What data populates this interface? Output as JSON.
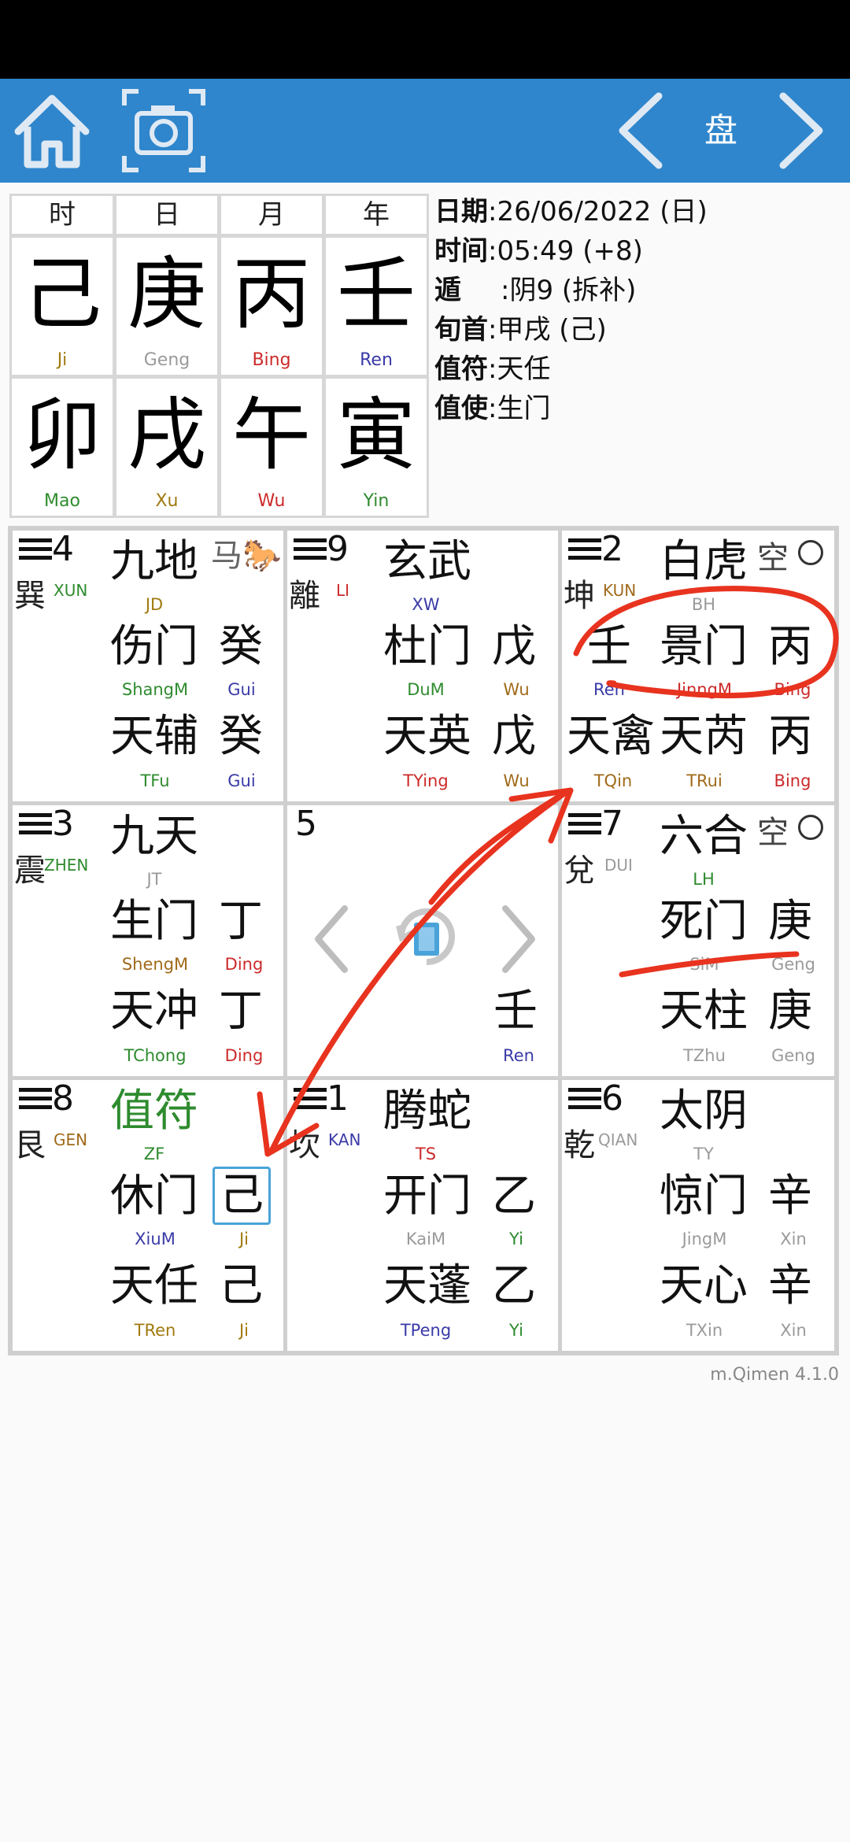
{
  "toolbar": {
    "home_icon": "home-icon",
    "camera_icon": "camera-icon",
    "title": "盘",
    "prev_icon": "chevron-left-icon",
    "next_icon": "chevron-right-icon"
  },
  "pillars": {
    "headers": [
      "时",
      "日",
      "月",
      "年"
    ],
    "stems": [
      "己",
      "庚",
      "丙",
      "壬"
    ],
    "stems_py": [
      "Ji",
      "Geng",
      "Bing",
      "Ren"
    ],
    "branches": [
      "卯",
      "戌",
      "午",
      "寅"
    ],
    "branches_py": [
      "Mao",
      "Xu",
      "Wu",
      "Yin"
    ]
  },
  "info": {
    "date_key": "日期",
    "date_val": ":26/06/2022 (日)",
    "time_key": "时间",
    "time_val": ":05:49 (+8)",
    "dun_key": "遁",
    "dun_val": ":阴9 (拆补)",
    "xun_key": "旬首",
    "xun_val": ":甲戌 (己)",
    "zhifu_key": "值符",
    "zhifu_val": ":天任",
    "zhishi_key": "值使",
    "zhishi_val": ":生门"
  },
  "grid": {
    "p4": {
      "num": "4",
      "name": "巽",
      "py": "XUN",
      "god": "九地",
      "god_py": "JD",
      "horse": "马🐎",
      "door": "伤门",
      "door_py": "ShangM",
      "door_stem": "癸",
      "door_stem_py": "Gui",
      "star": "天辅",
      "star_py": "TFu",
      "star_stem": "癸",
      "star_stem_py": "Gui"
    },
    "p9": {
      "num": "9",
      "name": "離",
      "py": "LI",
      "god": "玄武",
      "god_py": "XW",
      "door": "杜门",
      "door_py": "DuM",
      "door_stem": "戊",
      "door_stem_py": "Wu",
      "star": "天英",
      "star_py": "TYing",
      "star_stem": "戊",
      "star_stem_py": "Wu"
    },
    "p2": {
      "num": "2",
      "name": "坤",
      "py": "KUN",
      "god": "白虎",
      "god_py": "BH",
      "void": "空",
      "left_stem": "壬",
      "left_stem_py": "Ren",
      "door": "景门",
      "door_py": "JinngM",
      "door_stem": "丙",
      "door_stem_py": "Bing",
      "star0": "天禽",
      "star0_py": "TQin",
      "star": "天芮",
      "star_py": "TRui",
      "star_stem": "丙",
      "star_stem_py": "Bing"
    },
    "p3": {
      "num": "3",
      "name": "震",
      "py": "ZHEN",
      "god": "九天",
      "god_py": "JT",
      "door": "生门",
      "door_py": "ShengM",
      "door_stem": "丁",
      "door_stem_py": "Ding",
      "star": "天冲",
      "star_py": "TChong",
      "star_stem": "丁",
      "star_stem_py": "Ding"
    },
    "p5": {
      "num": "5",
      "stem": "壬",
      "stem_py": "Ren"
    },
    "p7": {
      "num": "7",
      "name": "兌",
      "py": "DUI",
      "god": "六合",
      "god_py": "LH",
      "void": "空",
      "door": "死门",
      "door_py": "SiM",
      "door_stem": "庚",
      "door_stem_py": "Geng",
      "star": "天柱",
      "star_py": "TZhu",
      "star_stem": "庚",
      "star_stem_py": "Geng"
    },
    "p8": {
      "num": "8",
      "name": "艮",
      "py": "GEN",
      "god": "值符",
      "god_py": "ZF",
      "door": "休门",
      "door_py": "XiuM",
      "door_stem": "己",
      "door_stem_py": "Ji",
      "star": "天任",
      "star_py": "TRen",
      "star_stem": "己",
      "star_stem_py": "Ji"
    },
    "p1": {
      "num": "1",
      "name": "坎",
      "py": "KAN",
      "god": "腾蛇",
      "god_py": "TS",
      "door": "开门",
      "door_py": "KaiM",
      "door_stem": "乙",
      "door_stem_py": "Yi",
      "star": "天蓬",
      "star_py": "TPeng",
      "star_stem": "乙",
      "star_stem_py": "Yi"
    },
    "p6": {
      "num": "6",
      "name": "乾",
      "py": "QIAN",
      "god": "太阴",
      "god_py": "TY",
      "door": "惊门",
      "door_py": "JingM",
      "door_stem": "辛",
      "door_stem_py": "Xin",
      "star": "天心",
      "star_py": "TXin",
      "star_stem": "辛",
      "star_stem_py": "Xin"
    }
  },
  "version": "m.Qimen 4.1.0",
  "colors": {
    "toolbar": "#2f86cc",
    "annotation": "#e8331f",
    "selected": "#4aa3d8"
  }
}
